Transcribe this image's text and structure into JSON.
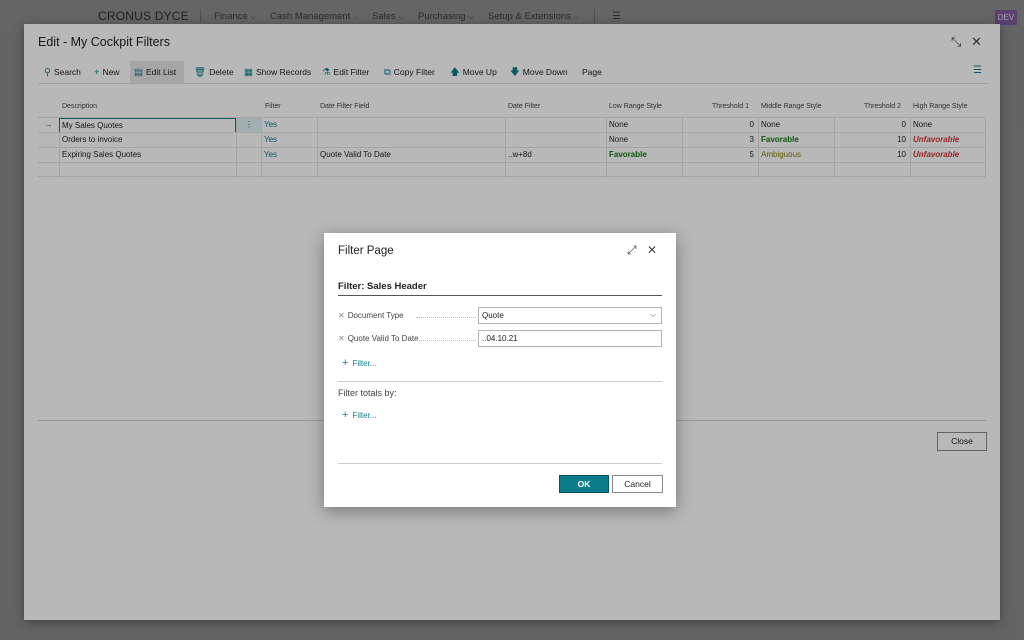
{
  "topnav": {
    "brand": "CRONUS DYCE",
    "items": [
      "Finance",
      "Cash Management",
      "Sales",
      "Purchasing",
      "Setup & Extensions"
    ],
    "badge": "DEV"
  },
  "main": {
    "title": "Edit - My Cockpit Filters",
    "toolbar": {
      "search": "Search",
      "new": "New",
      "edit_list": "Edit List",
      "delete": "Delete",
      "show_records": "Show Records",
      "edit_filter": "Edit Filter",
      "copy_filter": "Copy Filter",
      "move_up": "Move Up",
      "move_down": "Move Down",
      "page": "Page"
    },
    "columns": [
      "Description",
      "Filter",
      "Date Filter Field",
      "Date Filter",
      "Low Range Style",
      "Threshold 1",
      "Middle Range Style",
      "Threshold 2",
      "High Range Style"
    ],
    "rows": [
      {
        "description": "My Sales Quotes",
        "filter": "Yes",
        "date_filter_field": "",
        "date_filter": "",
        "low": "None",
        "t1": "0",
        "middle": "None",
        "t2": "0",
        "high": "None"
      },
      {
        "description": "Orders to invoice",
        "filter": "Yes",
        "date_filter_field": "",
        "date_filter": "",
        "low": "None",
        "t1": "3",
        "middle": "Favorable",
        "t2": "10",
        "high": "Unfavorable"
      },
      {
        "description": "Expiring Sales Quotes",
        "filter": "Yes",
        "date_filter_field": "Quote Valid To Date",
        "date_filter": "..w+8d",
        "low": "Favorable",
        "t1": "5",
        "middle": "Ambiguous",
        "t2": "10",
        "high": "Unfavorable"
      }
    ],
    "close_label": "Close"
  },
  "modal": {
    "title": "Filter Page",
    "subtitle": "Filter: Sales Header",
    "fields": [
      {
        "label": "Document Type",
        "value": "Quote"
      },
      {
        "label": "Quote Valid To Date",
        "value": "..04.10.21"
      }
    ],
    "add_filter": "Filter...",
    "totals_label": "Filter totals by:",
    "add_total_filter": "Filter...",
    "ok": "OK",
    "cancel": "Cancel"
  },
  "colors": {
    "accent": "#0c7f8e",
    "favorable": "#107c10",
    "unfavorable": "#d13438",
    "ambiguous": "#8a7f00"
  }
}
